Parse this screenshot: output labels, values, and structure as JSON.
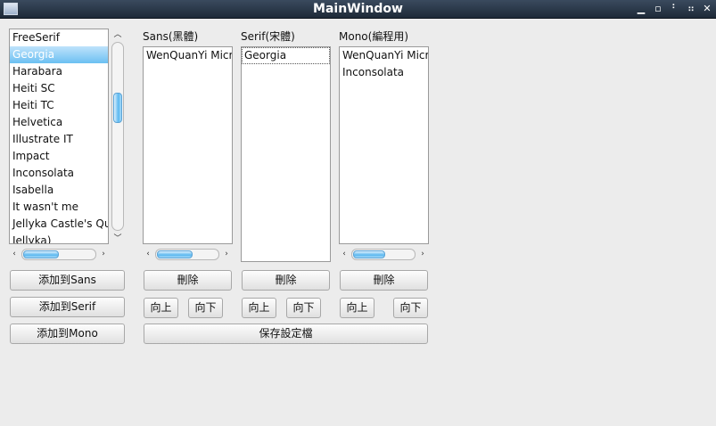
{
  "window": {
    "title": "MainWindow"
  },
  "font_list": {
    "items": [
      "FreeSerif",
      "Georgia",
      "Harabara",
      "Heiti SC",
      "Heiti TC",
      "Helvetica",
      "Illustrate IT",
      "Impact",
      "Inconsolata",
      "Isabella",
      "It wasn't me",
      "Jellyka Castle's Quee",
      "Jellyka)"
    ],
    "selected": "Georgia"
  },
  "sans": {
    "label": "Sans(黑體)",
    "items": [
      "WenQuanYi Micr"
    ],
    "delete": "刪除",
    "up": "向上",
    "down": "向下"
  },
  "serif": {
    "label": "Serif(宋體)",
    "items": [
      "Georgia"
    ],
    "delete": "刪除",
    "up": "向上",
    "down": "向下"
  },
  "mono": {
    "label": "Mono(編程用)",
    "items": [
      "WenQuanYi Micr",
      "Inconsolata"
    ],
    "delete": "刪除",
    "up": "向上",
    "down": "向下"
  },
  "actions": {
    "add_sans": "添加到Sans",
    "add_serif": "添加到Serif",
    "add_mono": "添加到Mono",
    "save": "保存設定檔"
  },
  "colors": {
    "selection": "#6cc0f2",
    "titlebar": "#1e2a38"
  }
}
